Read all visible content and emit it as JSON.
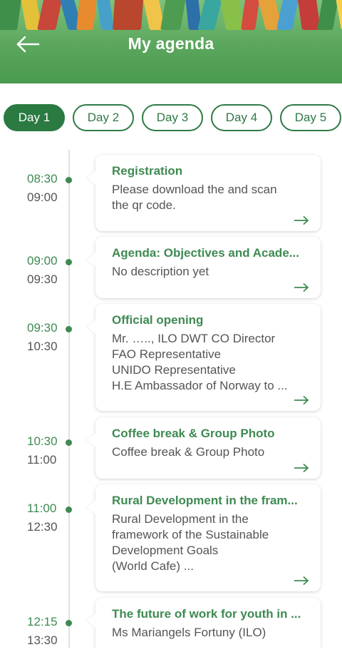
{
  "header": {
    "title": "My agenda",
    "back_icon": "arrow-left-icon"
  },
  "colors": {
    "primary": "#2a7a42",
    "accent_green": "#3e8a52",
    "header_gradient_top": "#7fc07a",
    "header_gradient_bottom": "#4a9a50"
  },
  "tabs": [
    {
      "label": "Day 1",
      "active": true
    },
    {
      "label": "Day 2",
      "active": false
    },
    {
      "label": "Day 3",
      "active": false
    },
    {
      "label": "Day 4",
      "active": false
    },
    {
      "label": "Day 5",
      "active": false
    }
  ],
  "sessions": [
    {
      "start": "08:30",
      "end": "09:00",
      "title": "Registration",
      "desc": [
        "Please download the and scan",
        "the qr code."
      ]
    },
    {
      "start": "09:00",
      "end": "09:30",
      "title": "Agenda: Objectives and Acade...",
      "desc": [
        "No description yet"
      ]
    },
    {
      "start": "09:30",
      "end": "10:30",
      "title": "Official opening",
      "desc": [
        "Mr. ….., ILO DWT CO Director",
        "FAO Representative",
        "UNIDO Representative",
        "H.E Ambassador of Norway to ..."
      ]
    },
    {
      "start": "10:30",
      "end": "11:00",
      "title": "Coffee break & Group Photo",
      "desc": [
        "Coffee break & Group Photo"
      ]
    },
    {
      "start": "11:00",
      "end": "12:30",
      "title": "Rural Development in the fram...",
      "desc": [
        "Rural Development in the",
        "framework of the Sustainable",
        "Development Goals",
        "(World Cafe) ..."
      ]
    },
    {
      "start": "12:15",
      "end": "13:30",
      "title": "The future of work for youth in ...",
      "desc": [
        "Ms Mariangels Fortuny (ILO)"
      ]
    }
  ]
}
